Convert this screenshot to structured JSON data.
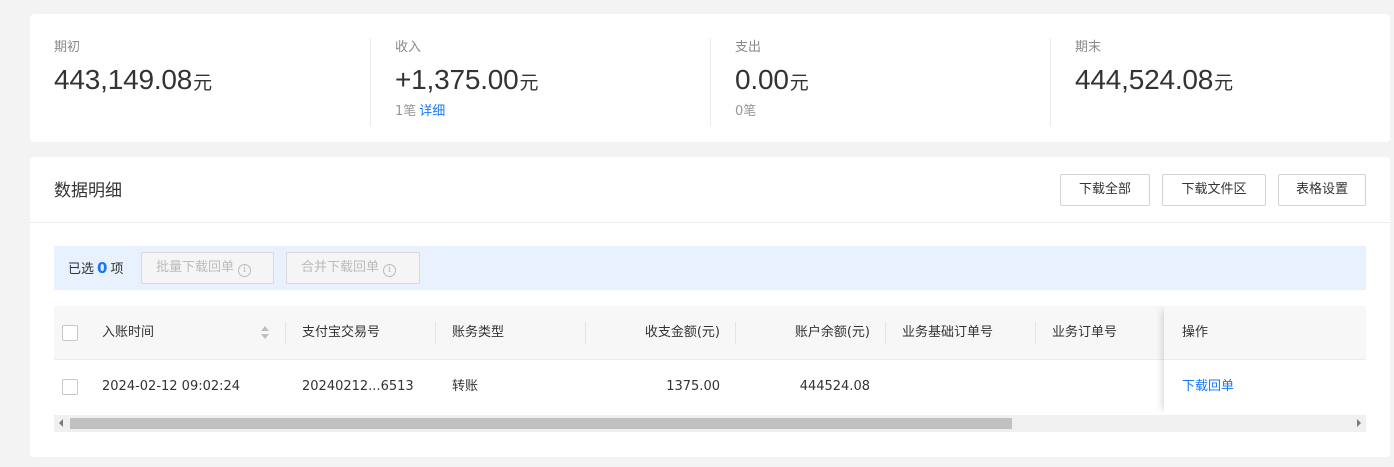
{
  "summary": {
    "opening": {
      "label": "期初",
      "value": "443,149.08",
      "unit": "元"
    },
    "income": {
      "label": "收入",
      "value": "+1,375.00",
      "unit": "元",
      "count": "1笔",
      "detail_link": "详细"
    },
    "expense": {
      "label": "支出",
      "value": "0.00",
      "unit": "元",
      "count": "0笔"
    },
    "closing": {
      "label": "期末",
      "value": "444,524.08",
      "unit": "元"
    }
  },
  "detail": {
    "title": "数据明细",
    "buttons": {
      "download_all": "下载全部",
      "download_area": "下载文件区",
      "table_settings": "表格设置"
    }
  },
  "selection": {
    "prefix": "已选",
    "count": "0",
    "suffix": "项",
    "batch_download": "批量下载回单",
    "merge_download": "合并下载回单",
    "info_glyph": "i"
  },
  "table": {
    "columns": {
      "time": "入账时间",
      "alipay_no": "支付宝交易号",
      "type": "账务类型",
      "amount": "收支金额(元)",
      "balance": "账户余额(元)",
      "base_order": "业务基础订单号",
      "order": "业务订单号",
      "action": "操作"
    },
    "rows": [
      {
        "time": "2024-02-12 09:02:24",
        "alipay_no": "20240212...6513",
        "type": "转账",
        "amount": "1375.00",
        "balance": "444524.08",
        "base_order": "",
        "order": "",
        "action": "下载回单"
      }
    ]
  },
  "colors": {
    "accent": "#1677ff",
    "selection_bg": "#e8f1fd",
    "page_bg": "#f3f3f3"
  },
  "icons": {
    "sort": "sort-icon",
    "info": "info-icon"
  }
}
